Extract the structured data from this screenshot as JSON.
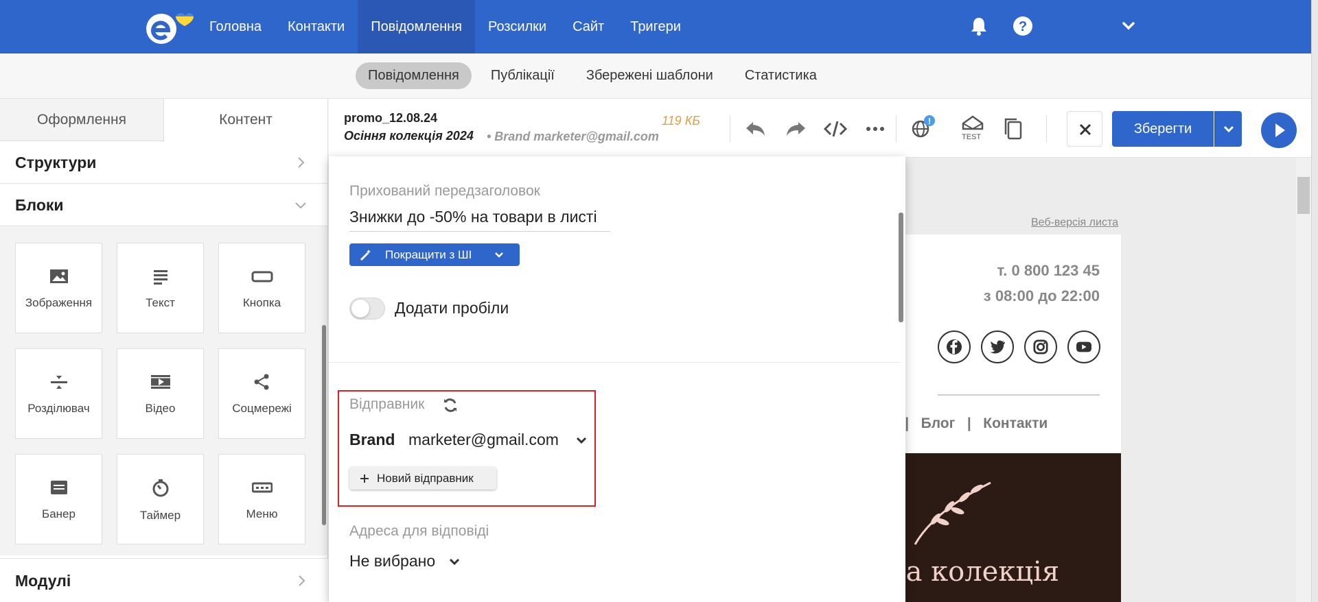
{
  "nav": {
    "items": [
      "Головна",
      "Контакти",
      "Повідомлення",
      "Розсилки",
      "Сайт",
      "Тригери"
    ],
    "active_index": 2
  },
  "subnav": {
    "tabs": [
      "Повідомлення",
      "Публікації",
      "Збережені шаблони",
      "Статистика"
    ]
  },
  "left_panel": {
    "tabs": [
      "Оформлення",
      "Контент"
    ],
    "structures": "Структури",
    "blocks_title": "Блоки",
    "blocks": [
      "Зображення",
      "Текст",
      "Кнопка",
      "Розділювач",
      "Відео",
      "Соцмережі",
      "Банер",
      "Таймер",
      "Меню"
    ],
    "modules": "Модулі"
  },
  "toolbar": {
    "name": "promo_12.08.24",
    "subject": "Осіння колекція 2024",
    "sender": "• Brand marketer@gmail.com",
    "size": "119 КБ",
    "test_label": "TEST",
    "save": "Зберегти"
  },
  "preview": {
    "web_version": "Веб-версія листа",
    "phone": "т. 0 800 123 45",
    "hours": "з 08:00 до 22:00",
    "menu_text": "нія   |   Блог   |   Контакти",
    "banner_text": "ова колекція"
  },
  "popup": {
    "preheader_label": "Прихований передзаголовок",
    "preheader_value": "Знижки до -50% на товари в листі",
    "ai_button": "Покращити з ШІ",
    "toggle_label": "Додати пробіли",
    "sender_label": "Відправник",
    "sender_name": "Brand",
    "sender_email": "marketer@gmail.com",
    "new_sender": "Новий відправник",
    "reply_label": "Адреса для відповіді",
    "reply_value": "Не вибрано"
  },
  "colors": {
    "brand_blue": "#2f66cc",
    "highlight_red": "#e02020",
    "size_orange": "#e0a040"
  }
}
